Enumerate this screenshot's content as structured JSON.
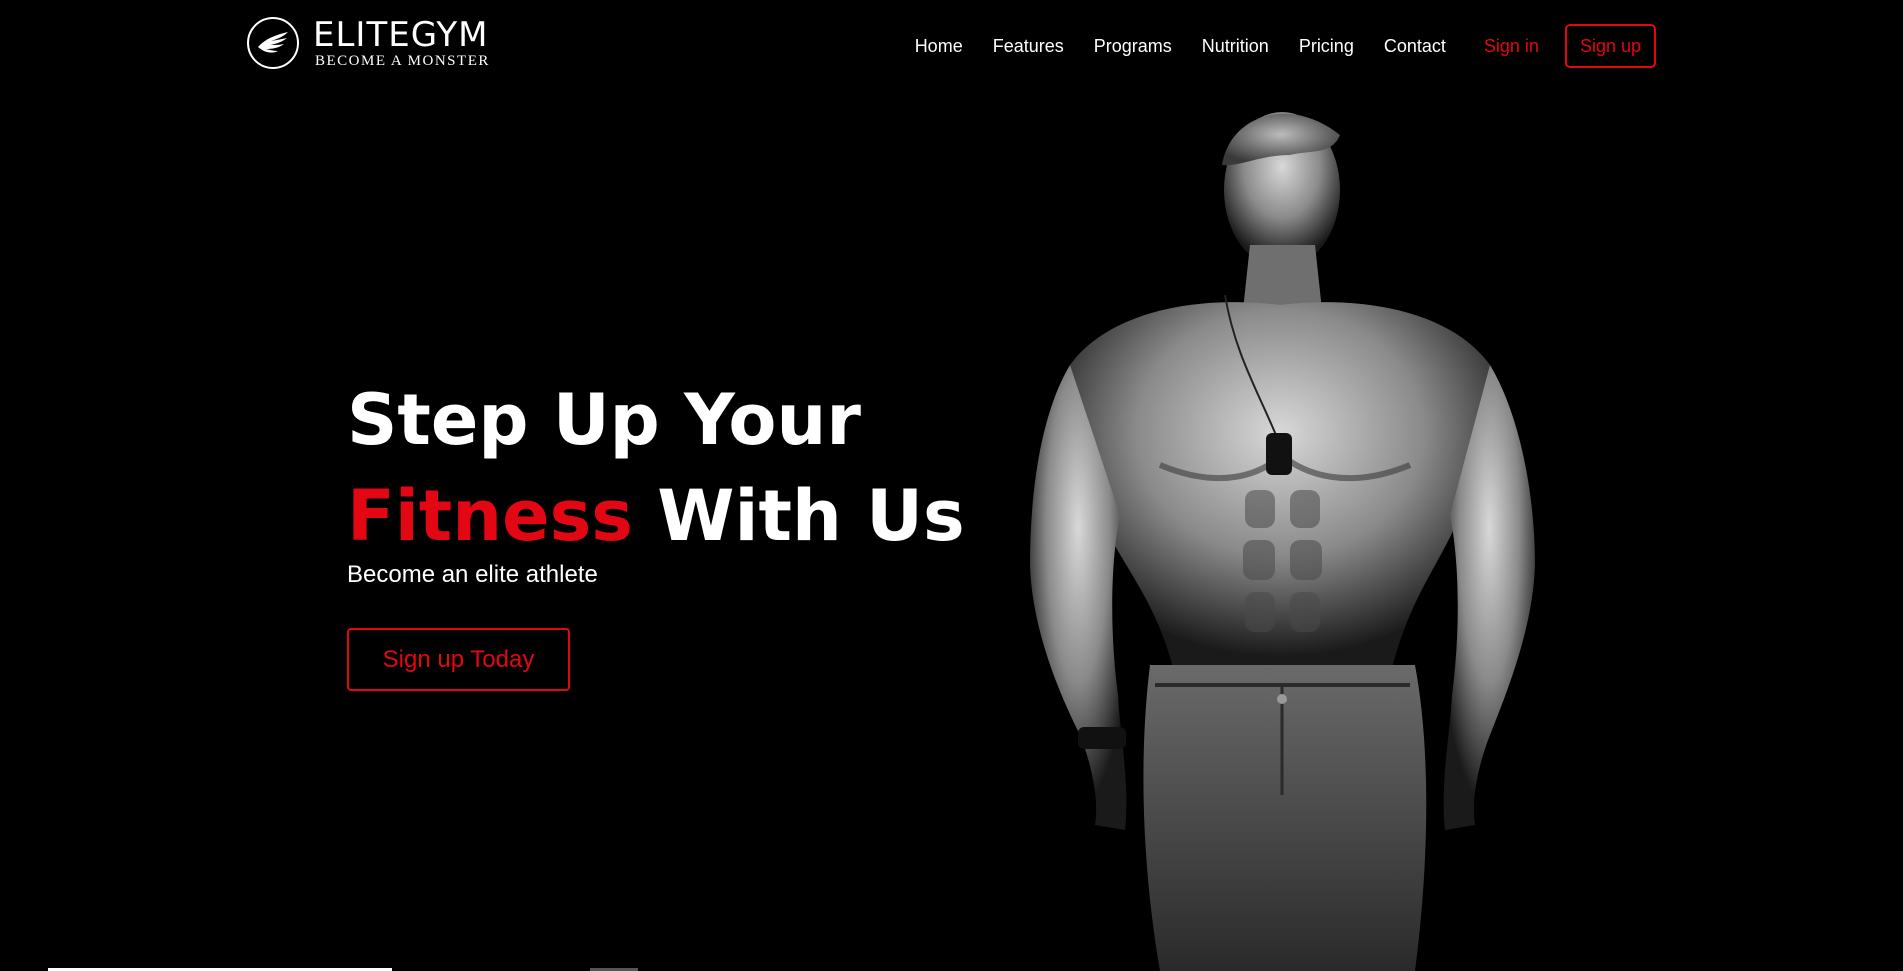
{
  "brand": {
    "name": "ELITEGYM",
    "tagline": "BECOME A MONSTER",
    "logo_icon": "wing-icon"
  },
  "nav": {
    "links": [
      "Home",
      "Features",
      "Programs",
      "Nutrition",
      "Pricing",
      "Contact"
    ],
    "signin_label": "Sign in",
    "signup_label": "Sign up"
  },
  "hero": {
    "title_line1": "Step Up Your",
    "title_accent": "Fitness",
    "title_rest": " With Us",
    "subtitle": "Become an elite athlete",
    "cta_label": "Sign up Today",
    "image": "muscular-man-photo"
  },
  "colors": {
    "background": "#000000",
    "accent": "#e30613",
    "text": "#ffffff"
  }
}
